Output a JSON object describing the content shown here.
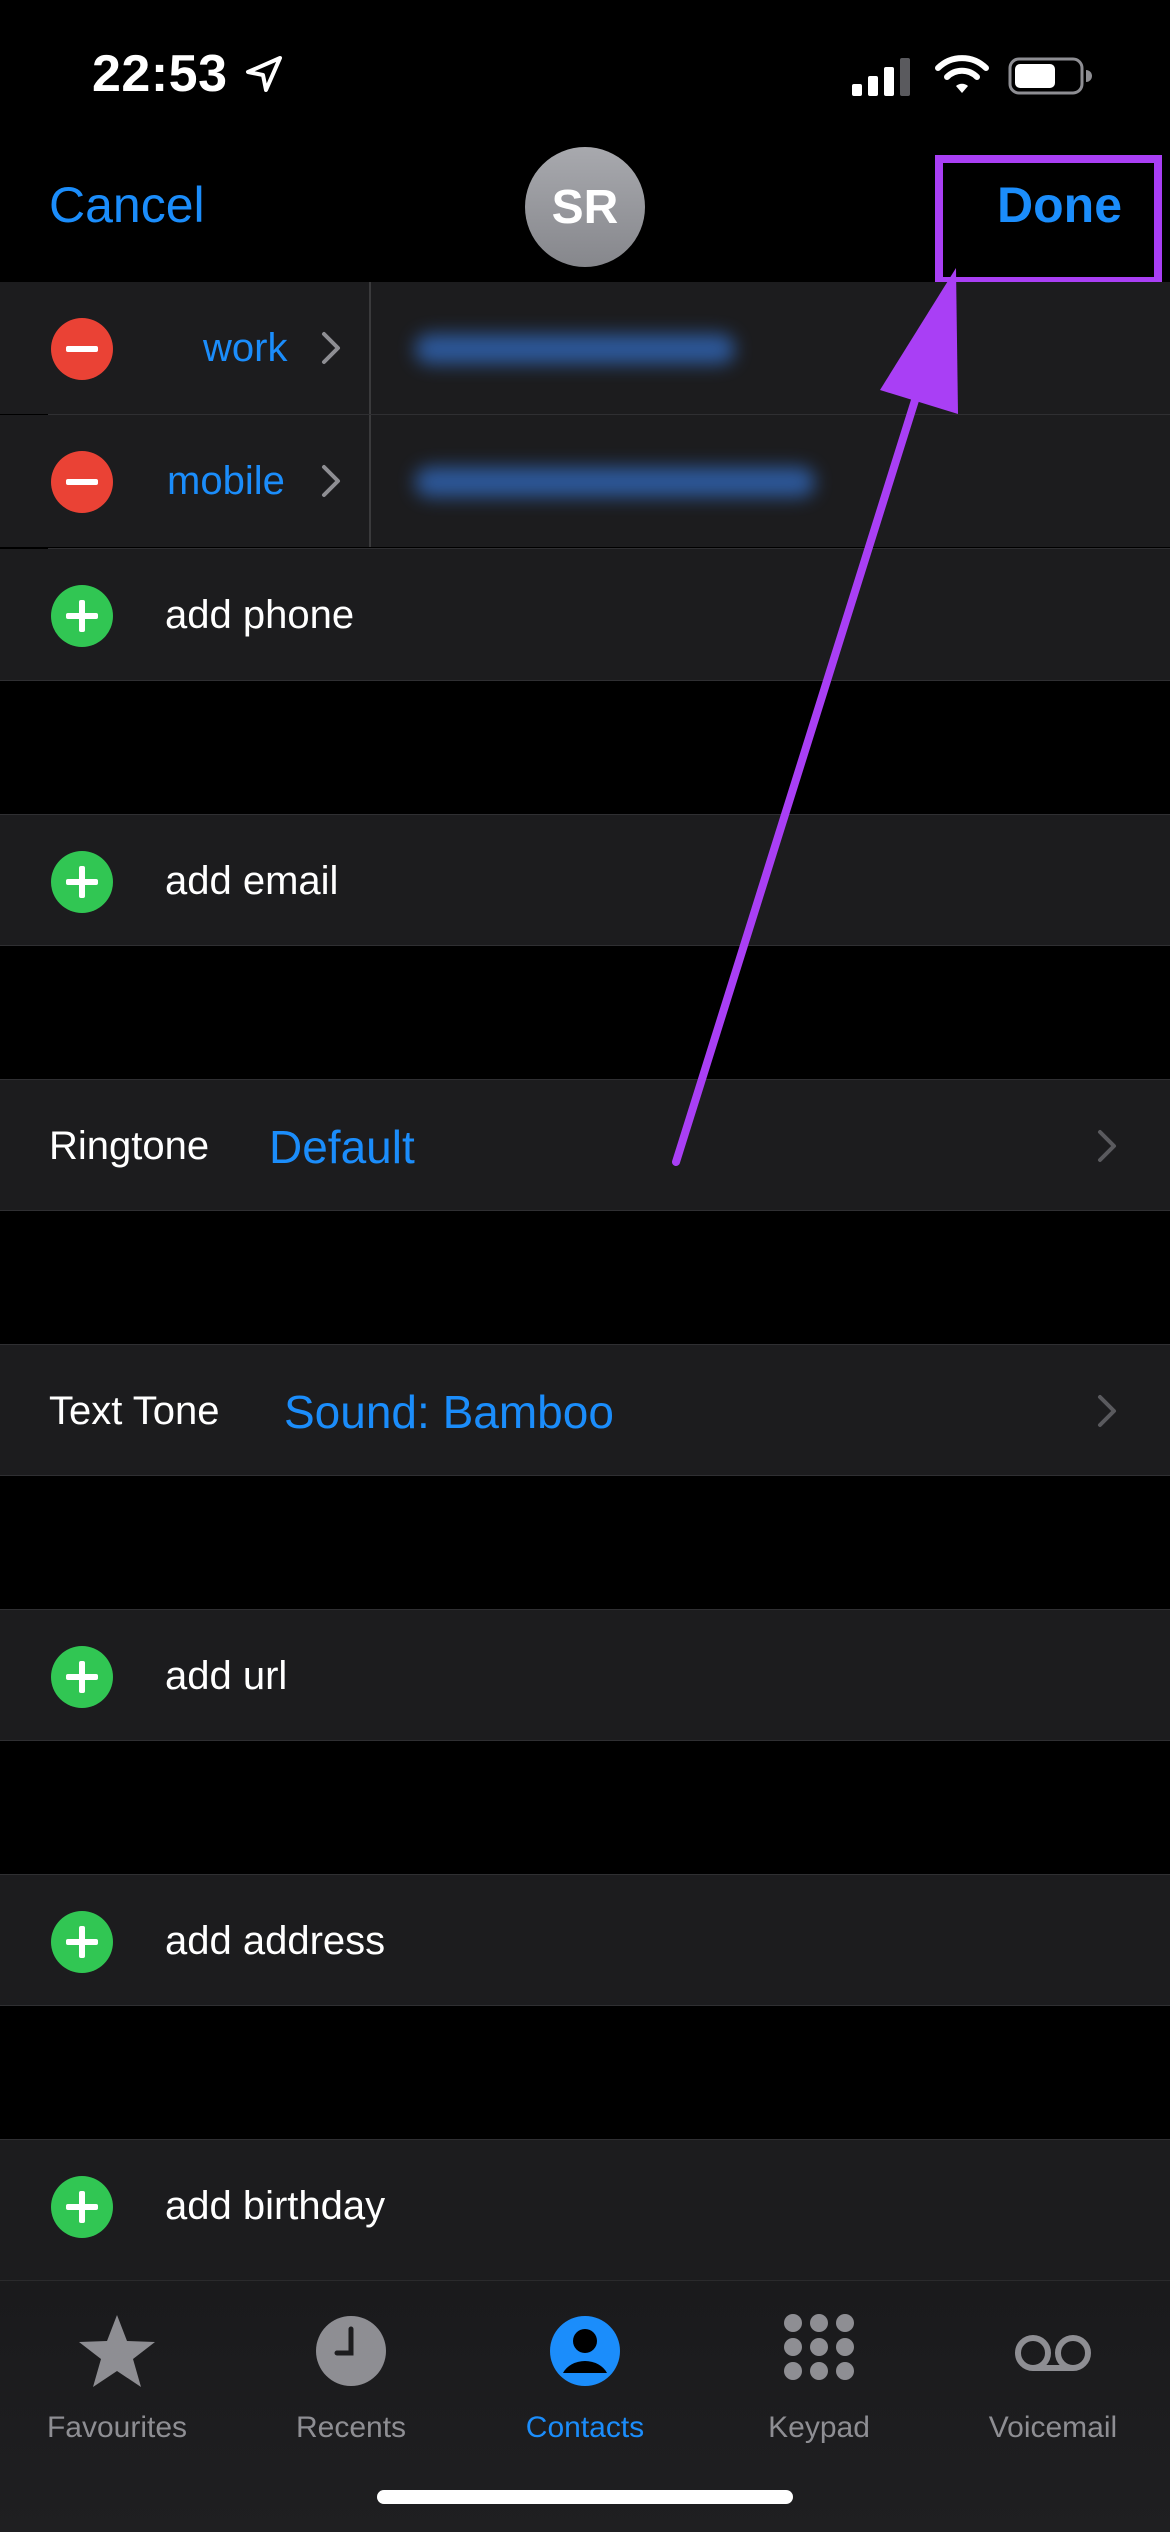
{
  "status_bar": {
    "time": "22:53"
  },
  "nav": {
    "cancel_label": "Cancel",
    "avatar_initials": "SR",
    "done_label": "Done"
  },
  "phone_rows": [
    {
      "label": "work"
    },
    {
      "label": "mobile"
    }
  ],
  "add_phone_label": "add phone",
  "add_email_label": "add email",
  "ringtone": {
    "label": "Ringtone",
    "value": "Default"
  },
  "text_tone": {
    "label": "Text Tone",
    "value": "Sound: Bamboo"
  },
  "add_url_label": "add url",
  "add_address_label": "add address",
  "add_birthday_label": "add birthday",
  "tabs": [
    {
      "label": "Favourites",
      "icon": "star-icon"
    },
    {
      "label": "Recents",
      "icon": "clock-icon"
    },
    {
      "label": "Contacts",
      "icon": "person-circle-icon",
      "active": true
    },
    {
      "label": "Keypad",
      "icon": "keypad-icon"
    },
    {
      "label": "Voicemail",
      "icon": "voicemail-icon"
    }
  ],
  "colors": {
    "accent": "#1b8dfb",
    "highlight": "#a93ff5",
    "remove": "#ea4235",
    "add": "#31c653"
  }
}
